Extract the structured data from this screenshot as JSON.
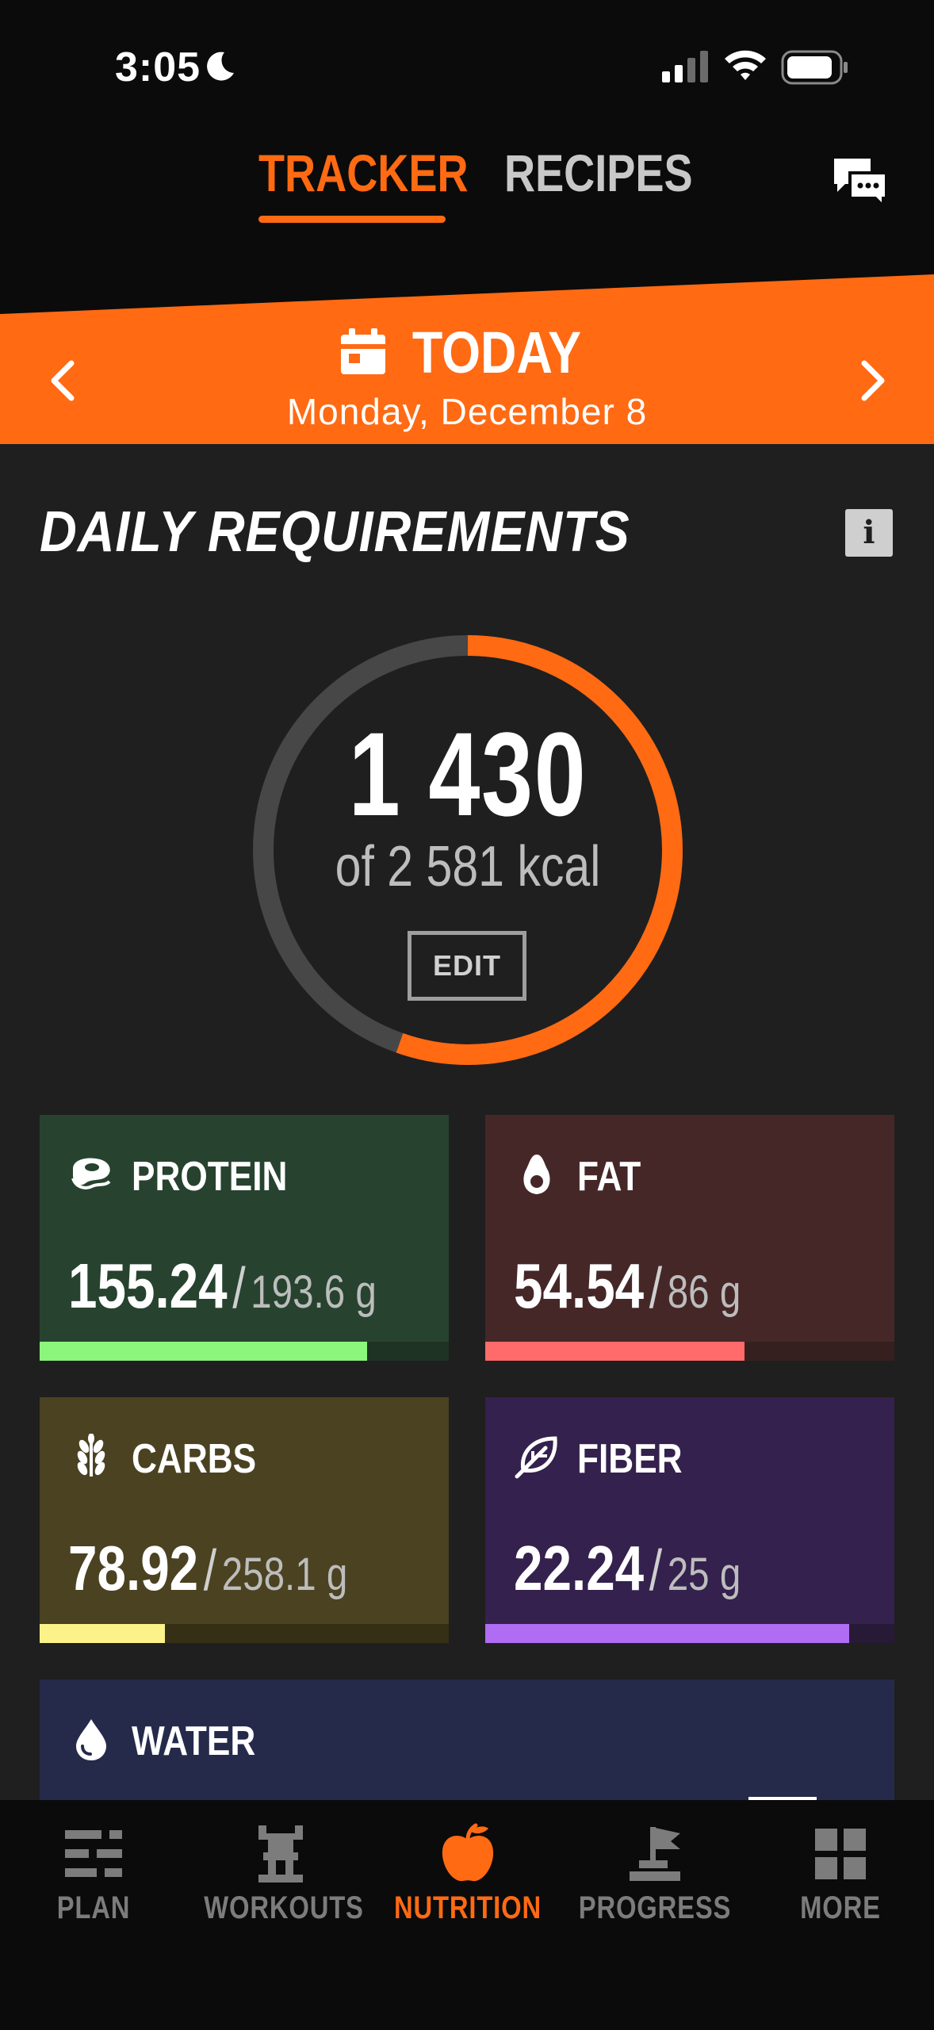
{
  "status_bar": {
    "time": "3:05"
  },
  "top_tabs": {
    "tracker": "TRACKER",
    "recipes": "RECIPES",
    "active": "tracker"
  },
  "banner": {
    "title": "TODAY",
    "date": "Monday, December 8",
    "color": "#ff6a13"
  },
  "daily": {
    "title": "DAILY REQUIREMENTS",
    "info_label": "i",
    "calories_consumed": "1 430",
    "calories_goal_text": "of 2 581 kcal",
    "progress_fraction": 0.554,
    "edit_label": "EDIT"
  },
  "macros": {
    "protein": {
      "label": "PROTEIN",
      "value": "155.24",
      "goal": "193.6 g",
      "fraction": 0.8,
      "color": "#8cf57c"
    },
    "fat": {
      "label": "FAT",
      "value": "54.54",
      "goal": "86 g",
      "fraction": 0.634,
      "color": "#ff6b6b"
    },
    "carbs": {
      "label": "CARBS",
      "value": "78.92",
      "goal": "258.1 g",
      "fraction": 0.306,
      "color": "#fbf28a"
    },
    "fiber": {
      "label": "FIBER",
      "value": "22.24",
      "goal": "25 g",
      "fraction": 0.89,
      "color": "#b06cf2"
    },
    "water": {
      "label": "WATER"
    },
    "separator": "/"
  },
  "bottom_nav": {
    "items": [
      {
        "label": "PLAN",
        "icon": "plan-icon"
      },
      {
        "label": "WORKOUTS",
        "icon": "workouts-icon"
      },
      {
        "label": "NUTRITION",
        "icon": "apple-icon"
      },
      {
        "label": "PROGRESS",
        "icon": "flag-icon"
      },
      {
        "label": "MORE",
        "icon": "grid-icon"
      }
    ],
    "active_index": 2
  }
}
